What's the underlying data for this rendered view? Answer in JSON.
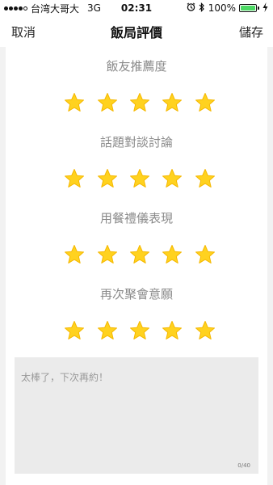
{
  "status_bar": {
    "carrier": "台湾大哥大",
    "network": "3G",
    "time": "02:31",
    "battery": "100%",
    "battery_color": "#4cd964"
  },
  "nav": {
    "cancel_label": "取消",
    "title": "飯局評價",
    "save_label": "儲存"
  },
  "ratings": [
    {
      "label": "飯友推薦度",
      "stars": 5,
      "max": 5
    },
    {
      "label": "話題對談討論",
      "stars": 5,
      "max": 5
    },
    {
      "label": "用餐禮儀表現",
      "stars": 5,
      "max": 5
    },
    {
      "label": "再次聚會意願",
      "stars": 5,
      "max": 5
    }
  ],
  "comment": {
    "text": "太棒了，下次再約！",
    "char_count": "0/40"
  },
  "colors": {
    "star": "#ffd21f",
    "star_shade": "#f5b800"
  }
}
